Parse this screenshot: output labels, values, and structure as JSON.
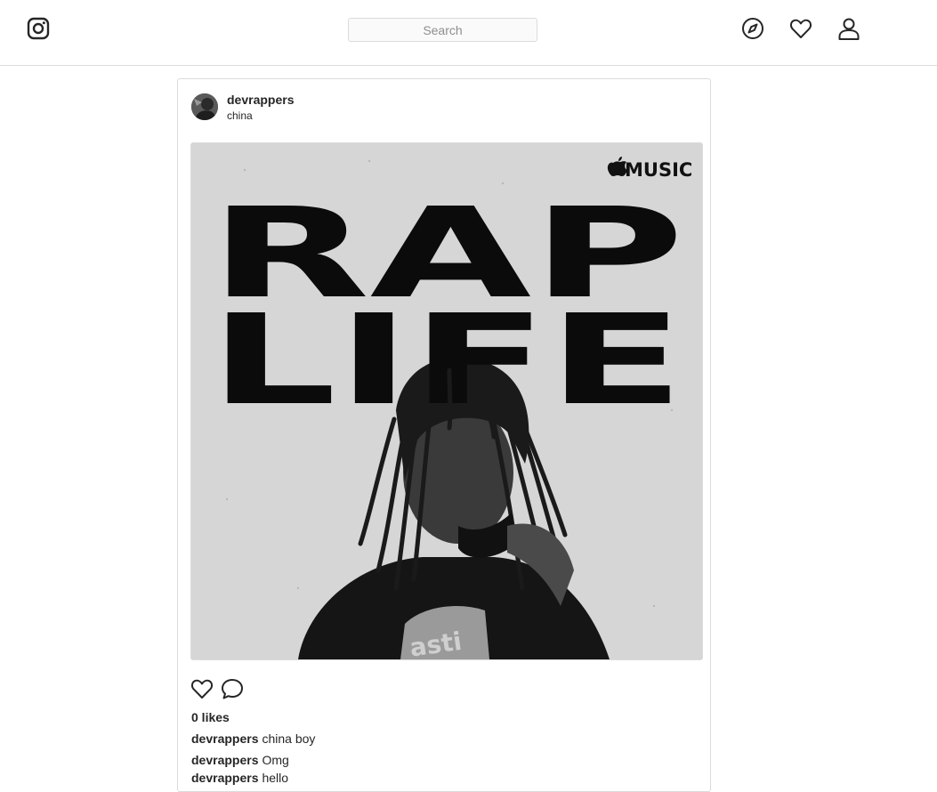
{
  "header": {
    "search_placeholder": "Search",
    "icons": [
      "instagram-logo-icon",
      "compass-icon",
      "heart-icon",
      "person-icon"
    ]
  },
  "post": {
    "username": "devrappers",
    "location": "china",
    "image": {
      "brand_text": "MUSIC",
      "title_line1": "RAP",
      "title_line2": "LIFE"
    },
    "likes_text": "0 likes",
    "caption": {
      "username": "devrappers",
      "text": "china boy"
    },
    "comments": [
      {
        "username": "devrappers",
        "text": "Omg"
      },
      {
        "username": "devrappers",
        "text": "hello"
      }
    ]
  },
  "colors": {
    "border": "#dbdbdb",
    "text": "#262626",
    "placeholder": "#8e8e8e"
  }
}
